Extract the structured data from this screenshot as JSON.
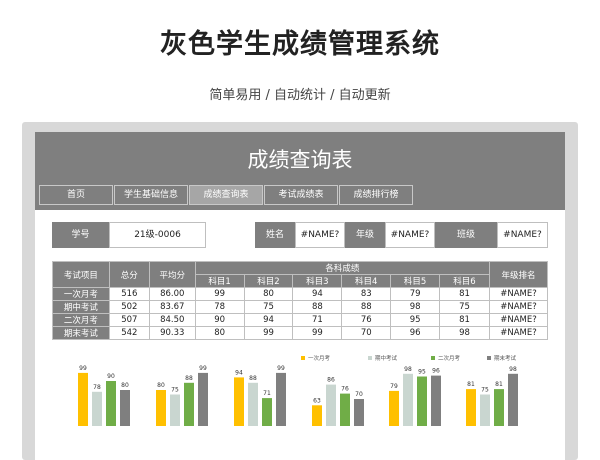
{
  "hero": {
    "title": "灰色学生成绩管理系统",
    "subtitle": "简单易用 / 自动统计 / 自动更新"
  },
  "sheet": {
    "title": "成绩查询表",
    "tabs": [
      "首页",
      "学生基础信息",
      "成绩查询表",
      "考试成绩表",
      "成绩排行榜"
    ],
    "active_tab": 2
  },
  "info": {
    "student_id_label": "学号",
    "student_id": "21级-0006",
    "name_label": "姓名",
    "name": "#NAME?",
    "grade_label": "年级",
    "grade": "#NAME?",
    "class_label": "班级",
    "class": "#NAME?"
  },
  "table": {
    "headers": {
      "exam": "考试项目",
      "total": "总分",
      "avg": "平均分",
      "subjects": "各科成绩",
      "rank": "年级排名"
    },
    "subjects": [
      "科目1",
      "科目2",
      "科目3",
      "科目4",
      "科目5",
      "科目6"
    ],
    "rows": [
      {
        "exam": "一次月考",
        "total": "516",
        "avg": "86.00",
        "scores": [
          "99",
          "80",
          "94",
          "83",
          "79",
          "81"
        ],
        "rank": "#NAME?"
      },
      {
        "exam": "期中考试",
        "total": "502",
        "avg": "83.67",
        "scores": [
          "78",
          "75",
          "88",
          "88",
          "98",
          "75"
        ],
        "rank": "#NAME?"
      },
      {
        "exam": "二次月考",
        "total": "507",
        "avg": "84.50",
        "scores": [
          "90",
          "94",
          "71",
          "76",
          "95",
          "81"
        ],
        "rank": "#NAME?"
      },
      {
        "exam": "期末考试",
        "total": "542",
        "avg": "90.33",
        "scores": [
          "80",
          "99",
          "99",
          "70",
          "96",
          "98"
        ],
        "rank": "#NAME?"
      }
    ]
  },
  "chart_data": {
    "type": "bar",
    "categories": [
      "科目1",
      "科目2",
      "科目3",
      "科目4",
      "科目5",
      "科目6"
    ],
    "series": [
      {
        "name": "一次月考",
        "color": "#ffc000",
        "values": [
          99,
          80,
          94,
          63,
          79,
          81
        ]
      },
      {
        "name": "期中考试",
        "color": "#c9d6d0",
        "values": [
          78,
          75,
          88,
          86,
          98,
          75
        ]
      },
      {
        "name": "二次月考",
        "color": "#70ad47",
        "values": [
          90,
          88,
          71,
          76,
          95,
          81
        ]
      },
      {
        "name": "期末考试",
        "color": "#7f7f7f",
        "values": [
          80,
          99,
          99,
          70,
          96,
          98
        ]
      }
    ],
    "legend": "top-right",
    "ylim": [
      40,
      100
    ]
  },
  "colors": {
    "header_gray": "#7f7f7f",
    "active_tab": "#a6a6a6"
  }
}
